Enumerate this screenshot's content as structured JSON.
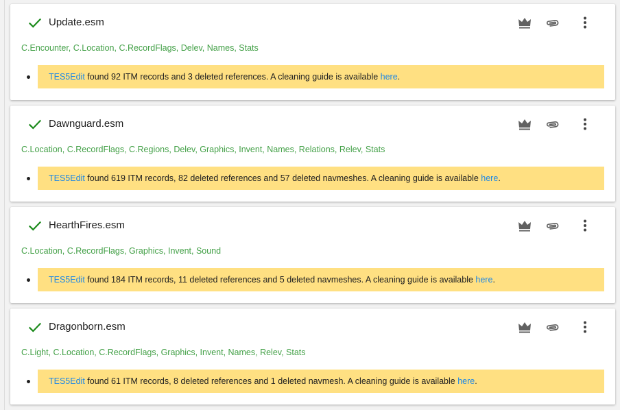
{
  "plugins": [
    {
      "name": "Update.esm",
      "tags": "C.Encounter, C.Location, C.RecordFlags, Delev, Names, Stats",
      "message": {
        "tool": "TES5Edit",
        "text": " found 92 ITM records and 3 deleted references. A cleaning guide is available ",
        "link": "here",
        "end": "."
      }
    },
    {
      "name": "Dawnguard.esm",
      "tags": "C.Location, C.RecordFlags, C.Regions, Delev, Graphics, Invent, Names, Relations, Relev, Stats",
      "message": {
        "tool": "TES5Edit",
        "text": " found 619 ITM records, 82 deleted references and 57 deleted navmeshes. A cleaning guide is available ",
        "link": "here",
        "end": "."
      }
    },
    {
      "name": "HearthFires.esm",
      "tags": "C.Location, C.RecordFlags, Graphics, Invent, Sound",
      "message": {
        "tool": "TES5Edit",
        "text": " found 184 ITM records, 11 deleted references and 5 deleted navmeshes. A cleaning guide is available ",
        "link": "here",
        "end": "."
      }
    },
    {
      "name": "Dragonborn.esm",
      "tags": "C.Light, C.Location, C.RecordFlags, Graphics, Invent, Names, Relev, Stats",
      "message": {
        "tool": "TES5Edit",
        "text": " found 61 ITM records, 8 deleted references and 1 deleted navmesh. A cleaning guide is available ",
        "link": "here",
        "end": "."
      }
    }
  ],
  "icons": {
    "status": "check-icon",
    "master": "crown-icon",
    "attachment": "paperclip-icon",
    "menu": "more-vert-icon"
  },
  "colors": {
    "check": "#1b8a1b",
    "tags": "#43a047",
    "message_bg": "#ffe082",
    "link": "#1e88e5",
    "icon": "#616161"
  }
}
